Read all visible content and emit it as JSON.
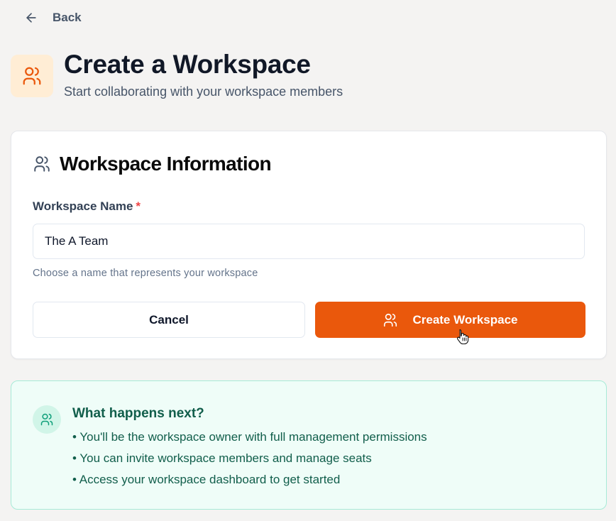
{
  "nav": {
    "back_label": "Back"
  },
  "header": {
    "title": "Create a Workspace",
    "subtitle": "Start collaborating with your workspace members",
    "icon": "users-icon"
  },
  "form_card": {
    "title": "Workspace Information",
    "title_icon": "users-icon",
    "name_field": {
      "label": "Workspace Name",
      "required_marker": "*",
      "value": "The A Team",
      "helper": "Choose a name that represents your workspace"
    },
    "cancel_label": "Cancel",
    "create_label": "Create Workspace",
    "create_icon": "users-icon"
  },
  "info": {
    "icon": "users-icon",
    "title": "What happens next?",
    "items": [
      "You'll be the workspace owner with full management permissions",
      "You can invite workspace members and manage seats",
      "Access your workspace dashboard to get started"
    ]
  },
  "colors": {
    "accent": "#ea580c",
    "accent_soft": "#ffedd5",
    "info_bg": "#effdf8",
    "info_border": "#a7ebd7",
    "info_text": "#115e4b",
    "required": "#ef4444"
  }
}
